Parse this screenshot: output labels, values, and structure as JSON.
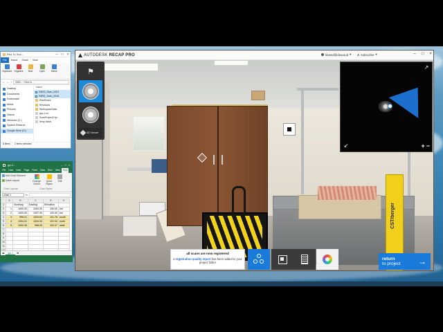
{
  "explorer": {
    "title": "Red 11 Sca...",
    "tabs": [
      "File",
      "Home",
      "Share",
      "View"
    ],
    "ribbon": [
      "Clipboard",
      "Organize",
      "New",
      "Open",
      "Select"
    ],
    "address": "2020... › Red 11...",
    "nav_items": [
      "Desktop",
      "Documents",
      "Downloads",
      "Music",
      "Pictures",
      "Videos",
      "Windows (C:)",
      "System Reserve",
      "Google Drive (G:)"
    ],
    "files_header": "Name",
    "files": [
      "FARO_Scan_0001",
      "FARO_Scan_0016",
      "RawScans",
      "Revisions",
      "WorkspaceData",
      "grp-2.rcr",
      "ScanProject2.fpr",
      "temp.harvs"
    ],
    "status_items": "8 items",
    "status_selected": "2 items selected"
  },
  "excel": {
    "title": "grp-1 -",
    "tabs": [
      "File",
      "Hom",
      "Inser",
      "Page",
      "Form",
      "Data",
      "Revi",
      "View",
      "Help"
    ],
    "ribbon": {
      "add_chart": "Add Chart Element",
      "quick_layout": "Quick Layout",
      "change_colors": "Change Colors",
      "quick_styles": "Quick Styles",
      "edit": "Edit",
      "chart_layouts": "Chart Layouts",
      "chart_styles": "Chart Styles"
    },
    "name_box": "Chart 1",
    "fx": "fx",
    "col_headers": [
      "",
      "A",
      "B",
      "C",
      "D",
      "E"
    ],
    "rows": [
      {
        "n": "1",
        "a": "",
        "b": "Northing",
        "c": "Easting",
        "d": "Elevation",
        "e": ""
      },
      {
        "n": "2",
        "a": "1",
        "b": "1000.00",
        "c": "1000.00",
        "d": "100.00",
        "e": "bm"
      },
      {
        "n": "3",
        "a": "2",
        "b": "1000.00",
        "c": "1007.93",
        "d": "100.00",
        "e": "bm"
      },
      {
        "n": "4",
        "a": "3",
        "b": "996.01",
        "c": "1003.62",
        "d": "101.76",
        "e": "south"
      },
      {
        "n": "5",
        "a": "4",
        "b": "1004.01",
        "c": "1004.00",
        "d": "101.94",
        "e": "north"
      },
      {
        "n": "6",
        "a": "5",
        "b": "1000.36",
        "c": "998.00",
        "d": "102.37",
        "e": "west"
      },
      {
        "n": "7",
        "a": "",
        "b": "",
        "c": "",
        "d": "",
        "e": ""
      },
      {
        "n": "8",
        "a": "",
        "b": "",
        "c": "",
        "d": "",
        "e": ""
      },
      {
        "n": "9",
        "a": "",
        "b": "",
        "c": "",
        "d": "",
        "e": ""
      },
      {
        "n": "10",
        "a": "",
        "b": "",
        "c": "",
        "d": "",
        "e": ""
      },
      {
        "n": "11",
        "a": "",
        "b": "",
        "c": "",
        "d": "",
        "e": ""
      },
      {
        "n": "12",
        "a": "",
        "b": "",
        "c": "",
        "d": "",
        "e": ""
      },
      {
        "n": "13",
        "a": "",
        "b": "",
        "c": "",
        "d": "",
        "e": ""
      }
    ],
    "sheet_tab": "grp-1"
  },
  "recap": {
    "brand_prefix": "AUTODESK",
    "brand_name": "RECAP PRO",
    "user": "klassd@duwood",
    "subscribe": "subscribe",
    "tool_3d_label": "3D Viewer",
    "stand_label": "CST/berger",
    "notice_title": "all scans are now registered",
    "notice_pre": "a ",
    "notice_link": "registration quality report",
    "notice_post": " has been added to your project folder",
    "return_line1": "return",
    "return_line2": "to project",
    "return_arrow": "→",
    "minimap_expand": "↗",
    "minimap_collapse": "↙",
    "zoom_plus": "+",
    "zoom_minus": "−"
  },
  "colors": {
    "accent": "#1a7bdb",
    "excel_green": "#217346",
    "toolbar_dark": "#3b3b3b"
  }
}
